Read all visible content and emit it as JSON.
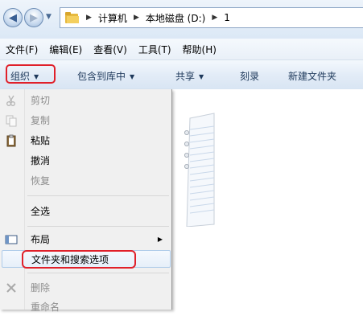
{
  "address": {
    "path": [
      "计算机",
      "本地磁盘 (D:)",
      "1"
    ]
  },
  "menubar": {
    "items": [
      "文件(F)",
      "编辑(E)",
      "查看(V)",
      "工具(T)",
      "帮助(H)"
    ]
  },
  "toolbar": {
    "organize": "组织",
    "include_library": "包含到库中",
    "share": "共享",
    "burn": "刻录",
    "new_folder": "新建文件夹"
  },
  "organize_menu": {
    "cut": "剪切",
    "copy": "复制",
    "paste": "粘贴",
    "undo": "撤消",
    "redo": "恢复",
    "select_all": "全选",
    "layout": "布局",
    "folder_options": "文件夹和搜索选项",
    "delete": "删除",
    "rename": "重命名"
  },
  "colors": {
    "highlight_border": "#e0202a",
    "toolbar_text": "#1e395b",
    "disabled_text": "#8d8d8d"
  }
}
